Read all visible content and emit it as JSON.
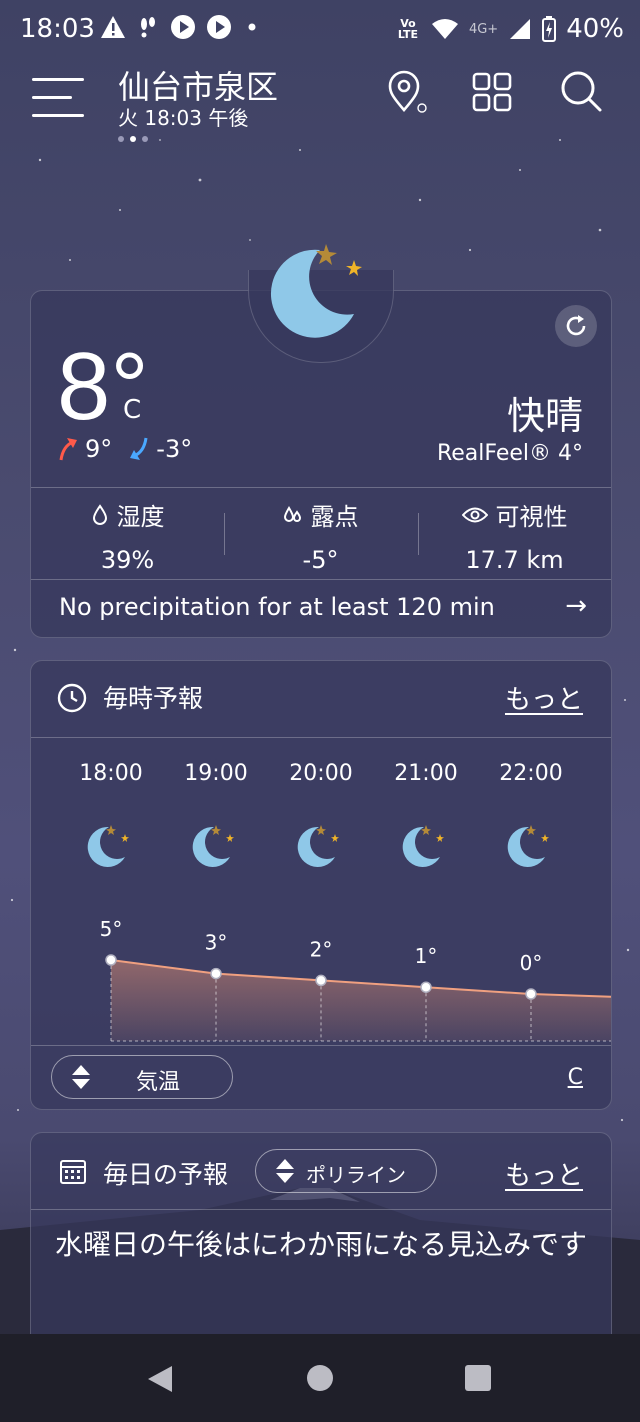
{
  "status": {
    "time": "18:03",
    "lte_label": "Vo LTE",
    "network": "4G+",
    "battery": "40%"
  },
  "header": {
    "city": "仙台市泉区",
    "subtitle": "火 18:03 午後",
    "page_dots": 3,
    "active_dot": 1
  },
  "current": {
    "temp": "8°",
    "unit": "C",
    "high": "9°",
    "low": "-3°",
    "condition": "快晴",
    "realfeel": "RealFeel® 4°",
    "stats": [
      {
        "label": "湿度",
        "value": "39%"
      },
      {
        "label": "露点",
        "value": "-5°"
      },
      {
        "label": "可視性",
        "value": "17.7 km"
      }
    ],
    "precip_text": "No precipitation for at least 120 min",
    "arrow": "→"
  },
  "hourly": {
    "title": "毎時予報",
    "more": "もっと",
    "hours": [
      {
        "time": "18:00",
        "temp": "5°",
        "t": 5
      },
      {
        "time": "19:00",
        "temp": "3°",
        "t": 3
      },
      {
        "time": "20:00",
        "temp": "2°",
        "t": 2
      },
      {
        "time": "21:00",
        "temp": "1°",
        "t": 1
      },
      {
        "time": "22:00",
        "temp": "0°",
        "t": 0
      }
    ],
    "toggle_label": "気温",
    "unit_label": "C"
  },
  "daily": {
    "title": "毎日の予報",
    "toggle_label": "ポリライン",
    "more": "もっと",
    "summary": "水曜日の午後はにわか雨になる見込みです"
  },
  "colors": {
    "moon": "#8fc8e8",
    "star": "#f0b428",
    "star_dim": "#b48a38",
    "high_arrow": "#ff5a4a",
    "low_arrow": "#4aa8ff",
    "chart_line": "#f0a080"
  }
}
